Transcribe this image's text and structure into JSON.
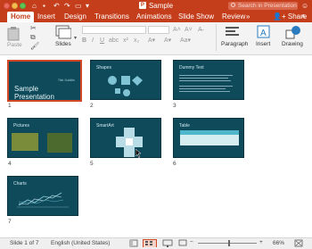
{
  "window": {
    "title": "Sample",
    "search_placeholder": "Search in Presentation"
  },
  "tabs": [
    {
      "label": "Home"
    },
    {
      "label": "Insert"
    },
    {
      "label": "Design"
    },
    {
      "label": "Transitions"
    },
    {
      "label": "Animations"
    },
    {
      "label": "Slide Show"
    },
    {
      "label": "Review"
    }
  ],
  "share_label": "Share",
  "ribbon": {
    "paste_label": "Paste",
    "slides_label": "Slides",
    "paragraph_label": "Paragraph",
    "insert_label": "Insert",
    "drawing_label": "Drawing"
  },
  "slides": [
    {
      "number": "1",
      "title": "Sample Presentation",
      "subtitle": "Title Subtitle",
      "selected": true
    },
    {
      "number": "2",
      "title": "Shapes"
    },
    {
      "number": "3",
      "title": "Dummy Text"
    },
    {
      "number": "4",
      "title": "Pictures"
    },
    {
      "number": "5",
      "title": "SmartArt"
    },
    {
      "number": "6",
      "title": "Table"
    },
    {
      "number": "7",
      "title": "Charts"
    }
  ],
  "status": {
    "slide_position": "Slide 1 of 7",
    "language": "English (United States)",
    "zoom": "66%"
  },
  "colors": {
    "accent": "#c43e1c",
    "slide_bg": "#0e4a5a",
    "selection": "#d24726"
  }
}
